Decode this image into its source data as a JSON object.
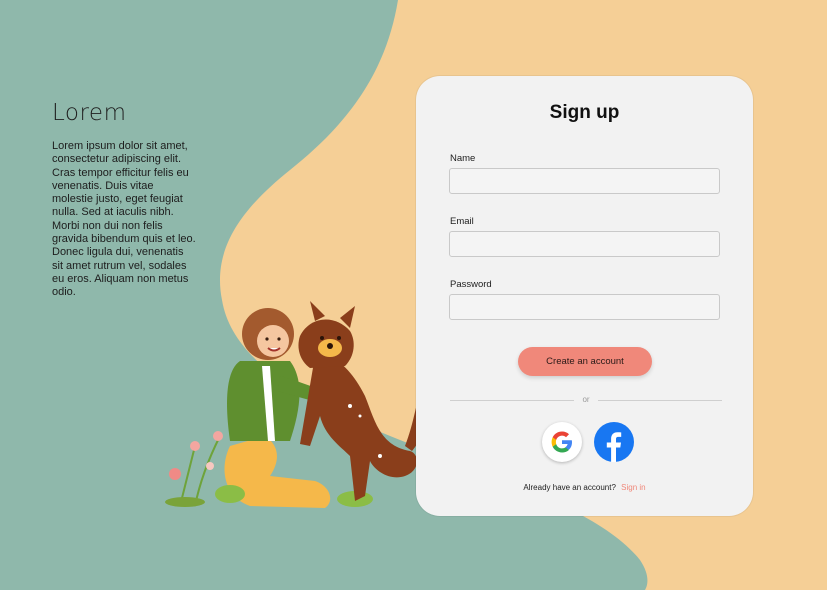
{
  "colors": {
    "teal_background": "#8fb8ab",
    "sand_background": "#f5cf96",
    "card_background": "#f2f2f2",
    "accent": "#f0887a",
    "facebook_blue": "#1877f2"
  },
  "hero": {
    "title": "Lorem",
    "text": "Lorem ipsum dolor sit amet, consectetur adipiscing elit. Cras tempor efficitur felis eu venenatis. Duis vitae molestie justo, eget feugiat nulla. Sed at iaculis nibh. Morbi non dui non felis gravida bibendum quis et leo. Donec ligula dui, venenatis sit amet rutrum vel, sodales eu eros. Aliquam non metus odio."
  },
  "illustration": {
    "subject": "person-hugging-dog",
    "icons": [
      "person-figure",
      "dog-figure",
      "flowers"
    ]
  },
  "form": {
    "title": "Sign up",
    "fields": [
      {
        "label": "Name",
        "value": "",
        "placeholder": ""
      },
      {
        "label": "Email",
        "value": "",
        "placeholder": ""
      },
      {
        "label": "Password",
        "value": "",
        "placeholder": ""
      }
    ],
    "submit_label": "Create an account",
    "divider_text": "or",
    "social": [
      {
        "provider": "Google",
        "icon": "google-icon"
      },
      {
        "provider": "Facebook",
        "icon": "facebook-icon"
      }
    ],
    "signin_prompt": "Already have an account?",
    "signin_link": "Sign in"
  }
}
